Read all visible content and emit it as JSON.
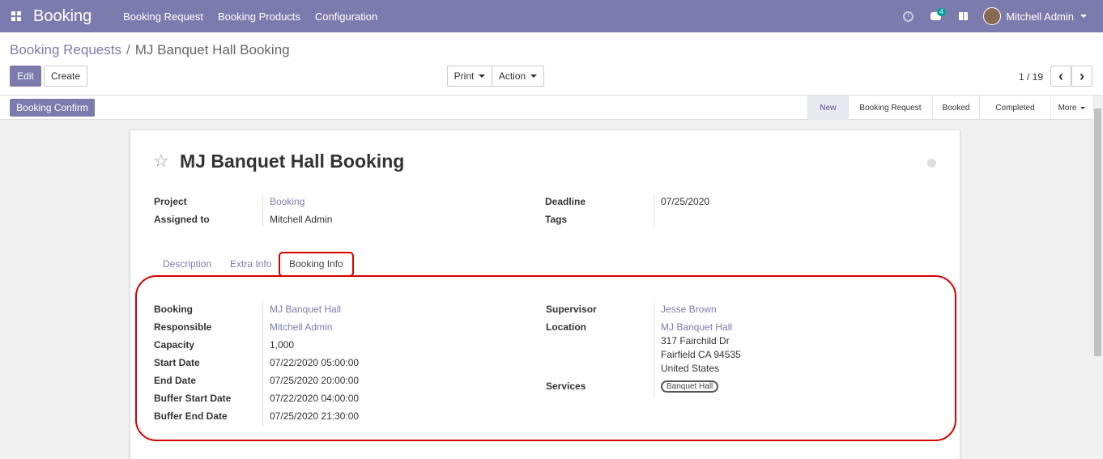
{
  "navbar": {
    "brand": "Booking",
    "menu": [
      "Booking Request",
      "Booking Products",
      "Configuration"
    ],
    "messages_badge": "4",
    "user_name": "Mitchell Admin"
  },
  "control": {
    "breadcrumb_parent": "Booking Requests",
    "breadcrumb_separator": "/",
    "breadcrumb_current": "MJ Banquet Hall Booking",
    "edit_label": "Edit",
    "create_label": "Create",
    "print_label": "Print",
    "action_label": "Action",
    "pager": "1 / 19",
    "prev_icon": "‹",
    "next_icon": "›"
  },
  "statusbar": {
    "confirm_label": "Booking Confirm",
    "steps": [
      "New",
      "Booking Request",
      "Booked",
      "Completed",
      "More"
    ],
    "active_step": "New"
  },
  "sheet": {
    "title": "MJ Banquet Hall Booking",
    "header_fields": {
      "project_label": "Project",
      "project_value": "Booking",
      "assigned_label": "Assigned to",
      "assigned_value": "Mitchell Admin",
      "deadline_label": "Deadline",
      "deadline_value": "07/25/2020",
      "tags_label": "Tags"
    },
    "tabs": [
      "Description",
      "Extra Info",
      "Booking Info"
    ],
    "active_tab": "Booking Info",
    "booking_info": {
      "left": [
        {
          "label": "Booking",
          "value": "MJ Banquet Hall",
          "link": true
        },
        {
          "label": "Responsible",
          "value": "Mitchell Admin",
          "link": true
        },
        {
          "label": "Capacity",
          "value": "1,000",
          "link": false
        },
        {
          "label": "Start Date",
          "value": "07/22/2020 05:00:00",
          "link": false
        },
        {
          "label": "End Date",
          "value": "07/25/2020 20:00:00",
          "link": false
        },
        {
          "label": "Buffer Start Date",
          "value": "07/22/2020 04:00:00",
          "link": false
        },
        {
          "label": "Buffer End Date",
          "value": "07/25/2020 21:30:00",
          "link": false
        }
      ],
      "supervisor_label": "Supervisor",
      "supervisor_value": "Jesse Brown",
      "location_label": "Location",
      "location_name": "MJ Banquet Hall",
      "location_street": "317 Fairchild Dr",
      "location_city": "Fairfield CA 94535",
      "location_country": "United States",
      "services_label": "Services",
      "services_tag": "Banquet Hall"
    }
  },
  "colors": {
    "brand": "#7c7bad",
    "highlight": "#d40000"
  }
}
